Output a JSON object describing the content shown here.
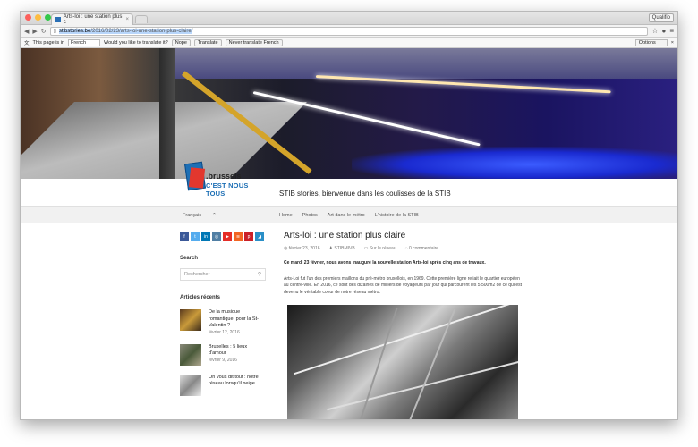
{
  "browser": {
    "tab_title": "Arts-loi : une station plus c",
    "profile": "Qualifio",
    "url_host": "stibstories.be",
    "url_path": "/2016/02/23/arts-loi-une-station-plus-claire/"
  },
  "translate_bar": {
    "label": "This page is in",
    "language": "French",
    "question": "Would you like to translate it?",
    "nope": "Nope",
    "translate": "Translate",
    "never": "Never translate French",
    "options": "Options"
  },
  "site": {
    "logo_top": ".brussels",
    "logo_bottom": "C'EST NOUS TOUS",
    "tagline": "STIB stories, bienvenue dans les coulisses de la STIB"
  },
  "nav": {
    "lang": "Français",
    "lang_caret": "⌃",
    "items": [
      "Home",
      "Photos",
      "Art dans le métro",
      "L'histoire de la STIB"
    ]
  },
  "sidebar": {
    "search_heading": "Search",
    "search_placeholder": "Rechercher",
    "recent_heading": "Articles récents",
    "recent": [
      {
        "title": "De la musique romantique, pour la St-Valentin ?",
        "date": "février 12, 2016"
      },
      {
        "title": "Bruxelles : 5 lieux d'amour",
        "date": "février 9, 2016"
      },
      {
        "title": "On vous dit tout : notre réseau lorsqu'il neige",
        "date": ""
      }
    ]
  },
  "post": {
    "title": "Arts-loi : une station plus claire",
    "date": "février 23, 2016",
    "author": "STIBMIVB",
    "category": "Sur le réseau",
    "comments": "0 commentaire",
    "lead": "Ce mardi 23 février, nous avons inauguré la nouvelle station Arts-loi après cinq ans de travaux.",
    "body": "Arts-Loi fut l'un des premiers maillons du pré-métro bruxellois, en 1969. Cette première ligne reliait le quartier européen au centre-ville. En 2016, ce sont des dizaines de milliers de voyageurs par jour qui parcourent les 5.500m2 de ce qui est devenu le véritable coeur de notre réseau métro."
  },
  "colors": {
    "facebook": "#3b5998",
    "twitter": "#55acee",
    "linkedin": "#0077b5",
    "instagram": "#517fa4",
    "youtube": "#e52d27",
    "rss": "#f26522",
    "pinterest": "#cb2027",
    "extra": "#2a8fc7"
  }
}
